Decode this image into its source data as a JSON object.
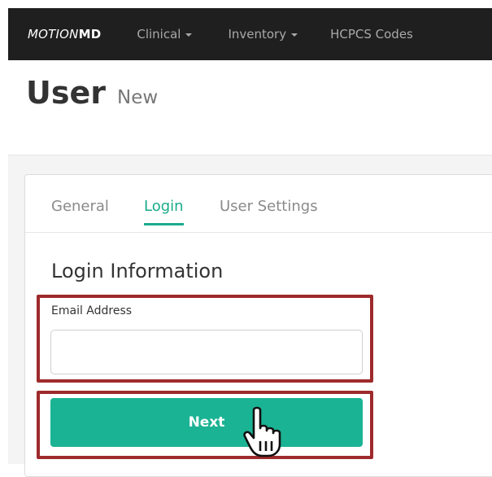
{
  "navbar": {
    "brand_part1": "MOTION",
    "brand_part2": "MD",
    "items": [
      {
        "label": "Clinical",
        "has_dropdown": true
      },
      {
        "label": "Inventory",
        "has_dropdown": true
      },
      {
        "label": "HCPCS Codes",
        "has_dropdown": false
      }
    ]
  },
  "page": {
    "title": "User",
    "subtitle": "New"
  },
  "tabs": [
    {
      "label": "General",
      "active": false
    },
    {
      "label": "Login",
      "active": true
    },
    {
      "label": "User Settings",
      "active": false
    }
  ],
  "form": {
    "section_title": "Login Information",
    "email_label": "Email Address",
    "email_value": "",
    "email_placeholder": "",
    "next_label": "Next"
  },
  "colors": {
    "navbar_bg": "#1f1f1f",
    "accent": "#1ab394",
    "highlight_border": "#9e2a2b"
  },
  "icons": {
    "cursor": "hand-pointer-icon"
  }
}
